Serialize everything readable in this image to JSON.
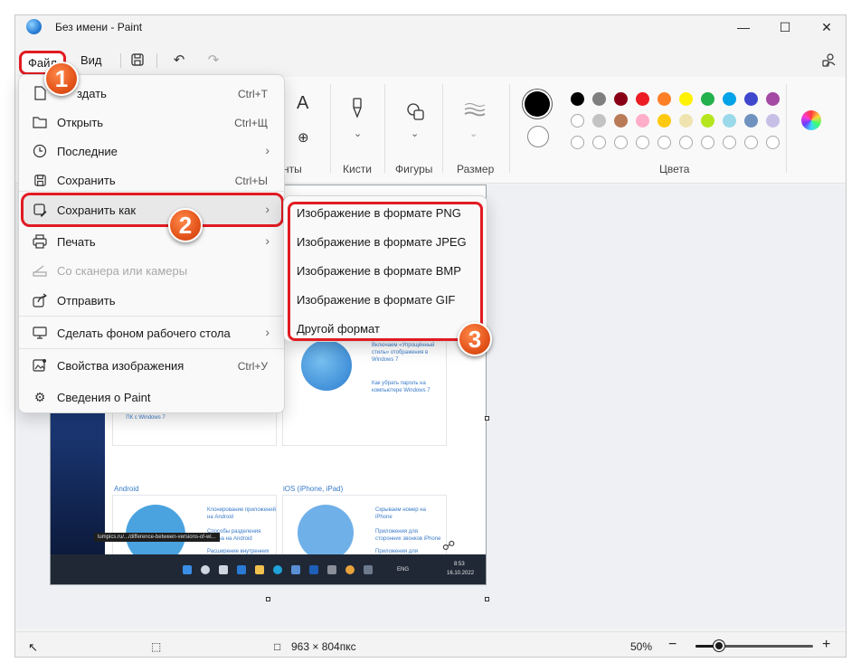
{
  "window": {
    "title": "Без имени - Paint"
  },
  "menubar": {
    "file": "Файл",
    "view": "Вид"
  },
  "ribbon": {
    "groups": {
      "tools_partial": "нты",
      "brushes": "Кисти",
      "shapes": "Фигуры",
      "size": "Размер",
      "colors": "Цвета"
    },
    "palette_row1": [
      "#000000",
      "#7f7f7f",
      "#880015",
      "#ed1c24",
      "#ff7f27",
      "#fff200",
      "#22b14c",
      "#00a2e8",
      "#3f48cc",
      "#a349a4"
    ],
    "palette_row2": [
      "#ffffff",
      "#c3c3c3",
      "#b97a57",
      "#ffaec9",
      "#ffc90e",
      "#efe4b0",
      "#b5e61d",
      "#99d9ea",
      "#7092be",
      "#c8bfe7"
    ]
  },
  "file_menu": {
    "items": [
      {
        "icon": "new-file-icon",
        "label": "Создать",
        "visible_label": "здать",
        "shortcut": "Ctrl+T"
      },
      {
        "icon": "folder-open-icon",
        "label": "Открыть",
        "shortcut": "Ctrl+Щ"
      },
      {
        "icon": "clock-icon",
        "label": "Последние",
        "arrow": true
      },
      {
        "icon": "save-icon",
        "label": "Сохранить",
        "shortcut": "Ctrl+Ы"
      },
      {
        "icon": "save-as-icon",
        "label": "Сохранить как",
        "arrow": true
      },
      {
        "icon": "print-icon",
        "label": "Печать",
        "arrow": true
      },
      {
        "icon": "scanner-icon",
        "label": "Со сканера или камеры",
        "disabled": true
      },
      {
        "icon": "share-icon",
        "label": "Отправить"
      },
      {
        "icon": "desktop-icon",
        "label": "Сделать фоном рабочего стола",
        "arrow": true
      },
      {
        "icon": "image-properties-icon",
        "label": "Свойства изображения",
        "shortcut": "Ctrl+У"
      },
      {
        "icon": "settings-icon",
        "label": "Сведения о Paint"
      }
    ]
  },
  "save_as_submenu": {
    "items": [
      "Изображение в формате PNG",
      "Изображение в формате JPEG",
      "Изображение в формате BMP",
      "Изображение в формате GIF",
      "Другой формат"
    ]
  },
  "badges": [
    "1",
    "2",
    "3"
  ],
  "image_content": {
    "cards_top": [
      "Узнаем пароль администратора на ПК с Windows 7",
      "Включаем «Упрощённый стиль» отображения в Windows 7",
      "Как убрать пароль на компьютере Windows 7"
    ],
    "section_android": "Android",
    "section_ios": "iOS (iPhone, iPad)",
    "android_links": [
      "Клонирование приложений на Android",
      "Способы разделения экрана на Android",
      "Расширение внутренних памяти на Android"
    ],
    "ios_links": [
      "Скрываем номер на iPhone",
      "Приложения для сторонних звонков iPhone",
      "Приложения для прослушивания музыки"
    ],
    "url": "lumpics.ru/.../difference-between-versions-of-wi...",
    "taskbar": {
      "lang": "ENG",
      "time": "8:53",
      "date": "16.10.2022"
    }
  },
  "status": {
    "size": "963 × 804пкс",
    "zoom": "50%",
    "zoom_level_fraction": 0.2
  }
}
